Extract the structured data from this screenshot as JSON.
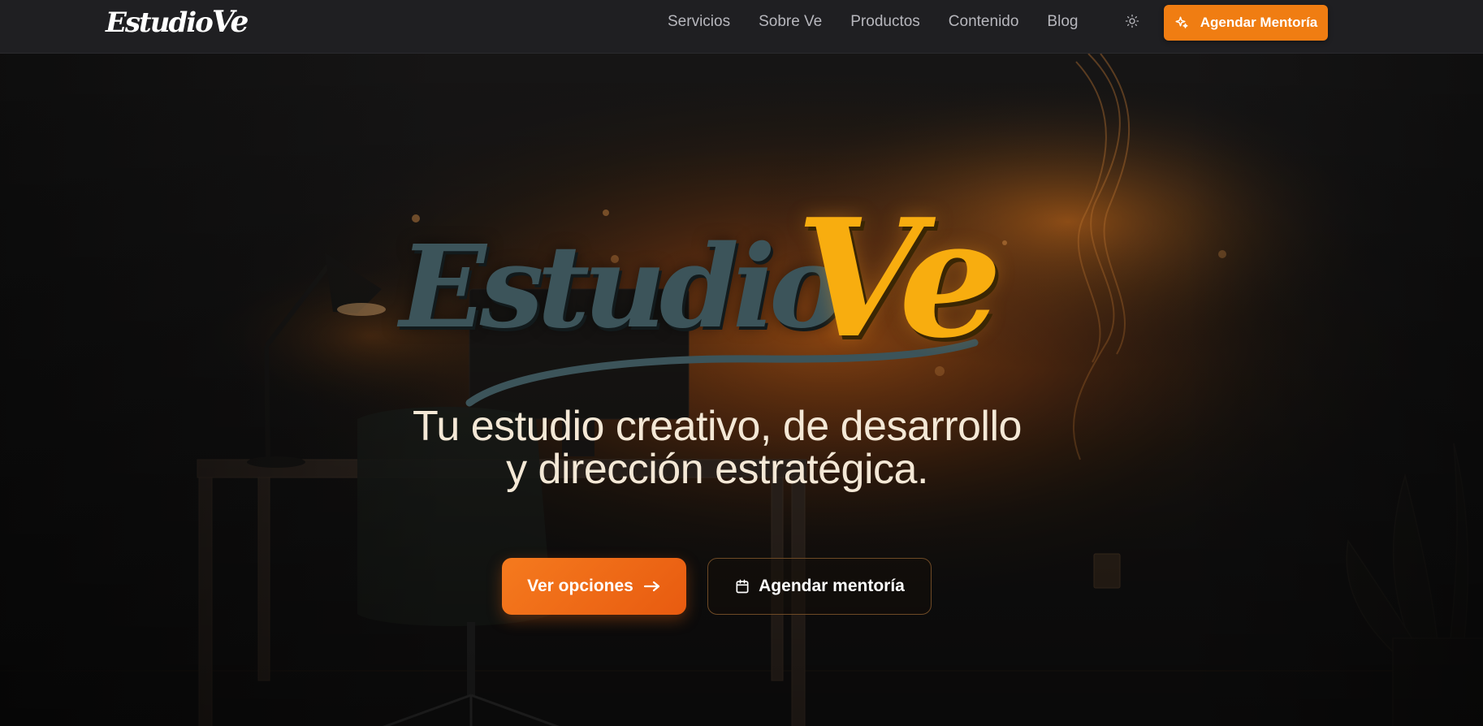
{
  "nav": {
    "logo_text_1": "Estudio",
    "logo_text_2": "Ve",
    "links": [
      "Servicios",
      "Sobre Ve",
      "Productos",
      "Contenido",
      "Blog"
    ],
    "theme_icon": "sun-icon",
    "cta_label": "Agendar Mentoría",
    "cta_icon": "sparkle-icon"
  },
  "hero": {
    "logo_part_1": "Estudio",
    "logo_part_2": "Ve",
    "title_line_1": "Tu estudio creativo, de desarrollo",
    "title_line_2": "y dirección estratégica.",
    "primary_button": "Ver opciones",
    "primary_icon": "arrow-right-icon",
    "secondary_button": "Agendar mentoría",
    "secondary_icon": "calendar-icon"
  },
  "colors": {
    "accent": "#f07d12",
    "logo_teal": "#3c545a",
    "logo_gold": "#f8ad0f",
    "title_text": "#f4e8d6",
    "nav_bg": "#1f1f22"
  }
}
